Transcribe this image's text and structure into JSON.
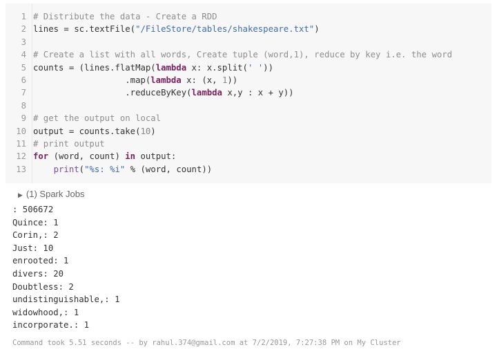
{
  "code_lines": [
    [
      {
        "t": "# Distribute the data - Create a RDD",
        "c": "comment"
      }
    ],
    [
      {
        "t": "lines = sc.textFile(",
        "c": ""
      },
      {
        "t": "\"/FileStore/tables/shakespeare.txt\"",
        "c": "str"
      },
      {
        "t": ")",
        "c": ""
      }
    ],
    [],
    [
      {
        "t": "# Create a list with all words, Create tuple (word,1), reduce by key i.e. the word",
        "c": "comment"
      }
    ],
    [
      {
        "t": "counts = (lines.flatMap(",
        "c": ""
      },
      {
        "t": "lambda",
        "c": "kw"
      },
      {
        "t": " x: x.split(",
        "c": ""
      },
      {
        "t": "' '",
        "c": "str"
      },
      {
        "t": "))",
        "c": ""
      }
    ],
    [
      {
        "t": "                  .map(",
        "c": ""
      },
      {
        "t": "lambda",
        "c": "kw"
      },
      {
        "t": " x: (x, ",
        "c": ""
      },
      {
        "t": "1",
        "c": "num"
      },
      {
        "t": "))",
        "c": ""
      }
    ],
    [
      {
        "t": "                  .reduceByKey(",
        "c": ""
      },
      {
        "t": "lambda",
        "c": "kw"
      },
      {
        "t": " x,y : x + y))",
        "c": ""
      }
    ],
    [],
    [
      {
        "t": "# get the output on local",
        "c": "comment"
      }
    ],
    [
      {
        "t": "output = counts.take(",
        "c": ""
      },
      {
        "t": "10",
        "c": "num"
      },
      {
        "t": ")",
        "c": ""
      }
    ],
    [
      {
        "t": "# print output",
        "c": "comment"
      }
    ],
    [
      {
        "t": "for",
        "c": "kw"
      },
      {
        "t": " (word, count) ",
        "c": ""
      },
      {
        "t": "in",
        "c": "kw"
      },
      {
        "t": " output:",
        "c": ""
      }
    ],
    [
      {
        "t": "    ",
        "c": ""
      },
      {
        "t": "print",
        "c": "fn"
      },
      {
        "t": "(",
        "c": ""
      },
      {
        "t": "\"%s: %i\"",
        "c": "str"
      },
      {
        "t": " % (word, count))",
        "c": ""
      }
    ]
  ],
  "spark_jobs_label": "(1) Spark Jobs",
  "output_lines": [
    ": 506672",
    "Quince: 1",
    "Corin,: 2",
    "Just: 10",
    "enrooted: 1",
    "divers: 20",
    "Doubtless: 2",
    "undistinguishable,: 1",
    "widowhood,: 1",
    "incorporate.: 1"
  ],
  "footer": "Command took 5.51 seconds -- by rahul.374@gmail.com at 7/2/2019, 7:27:38 PM on My Cluster"
}
